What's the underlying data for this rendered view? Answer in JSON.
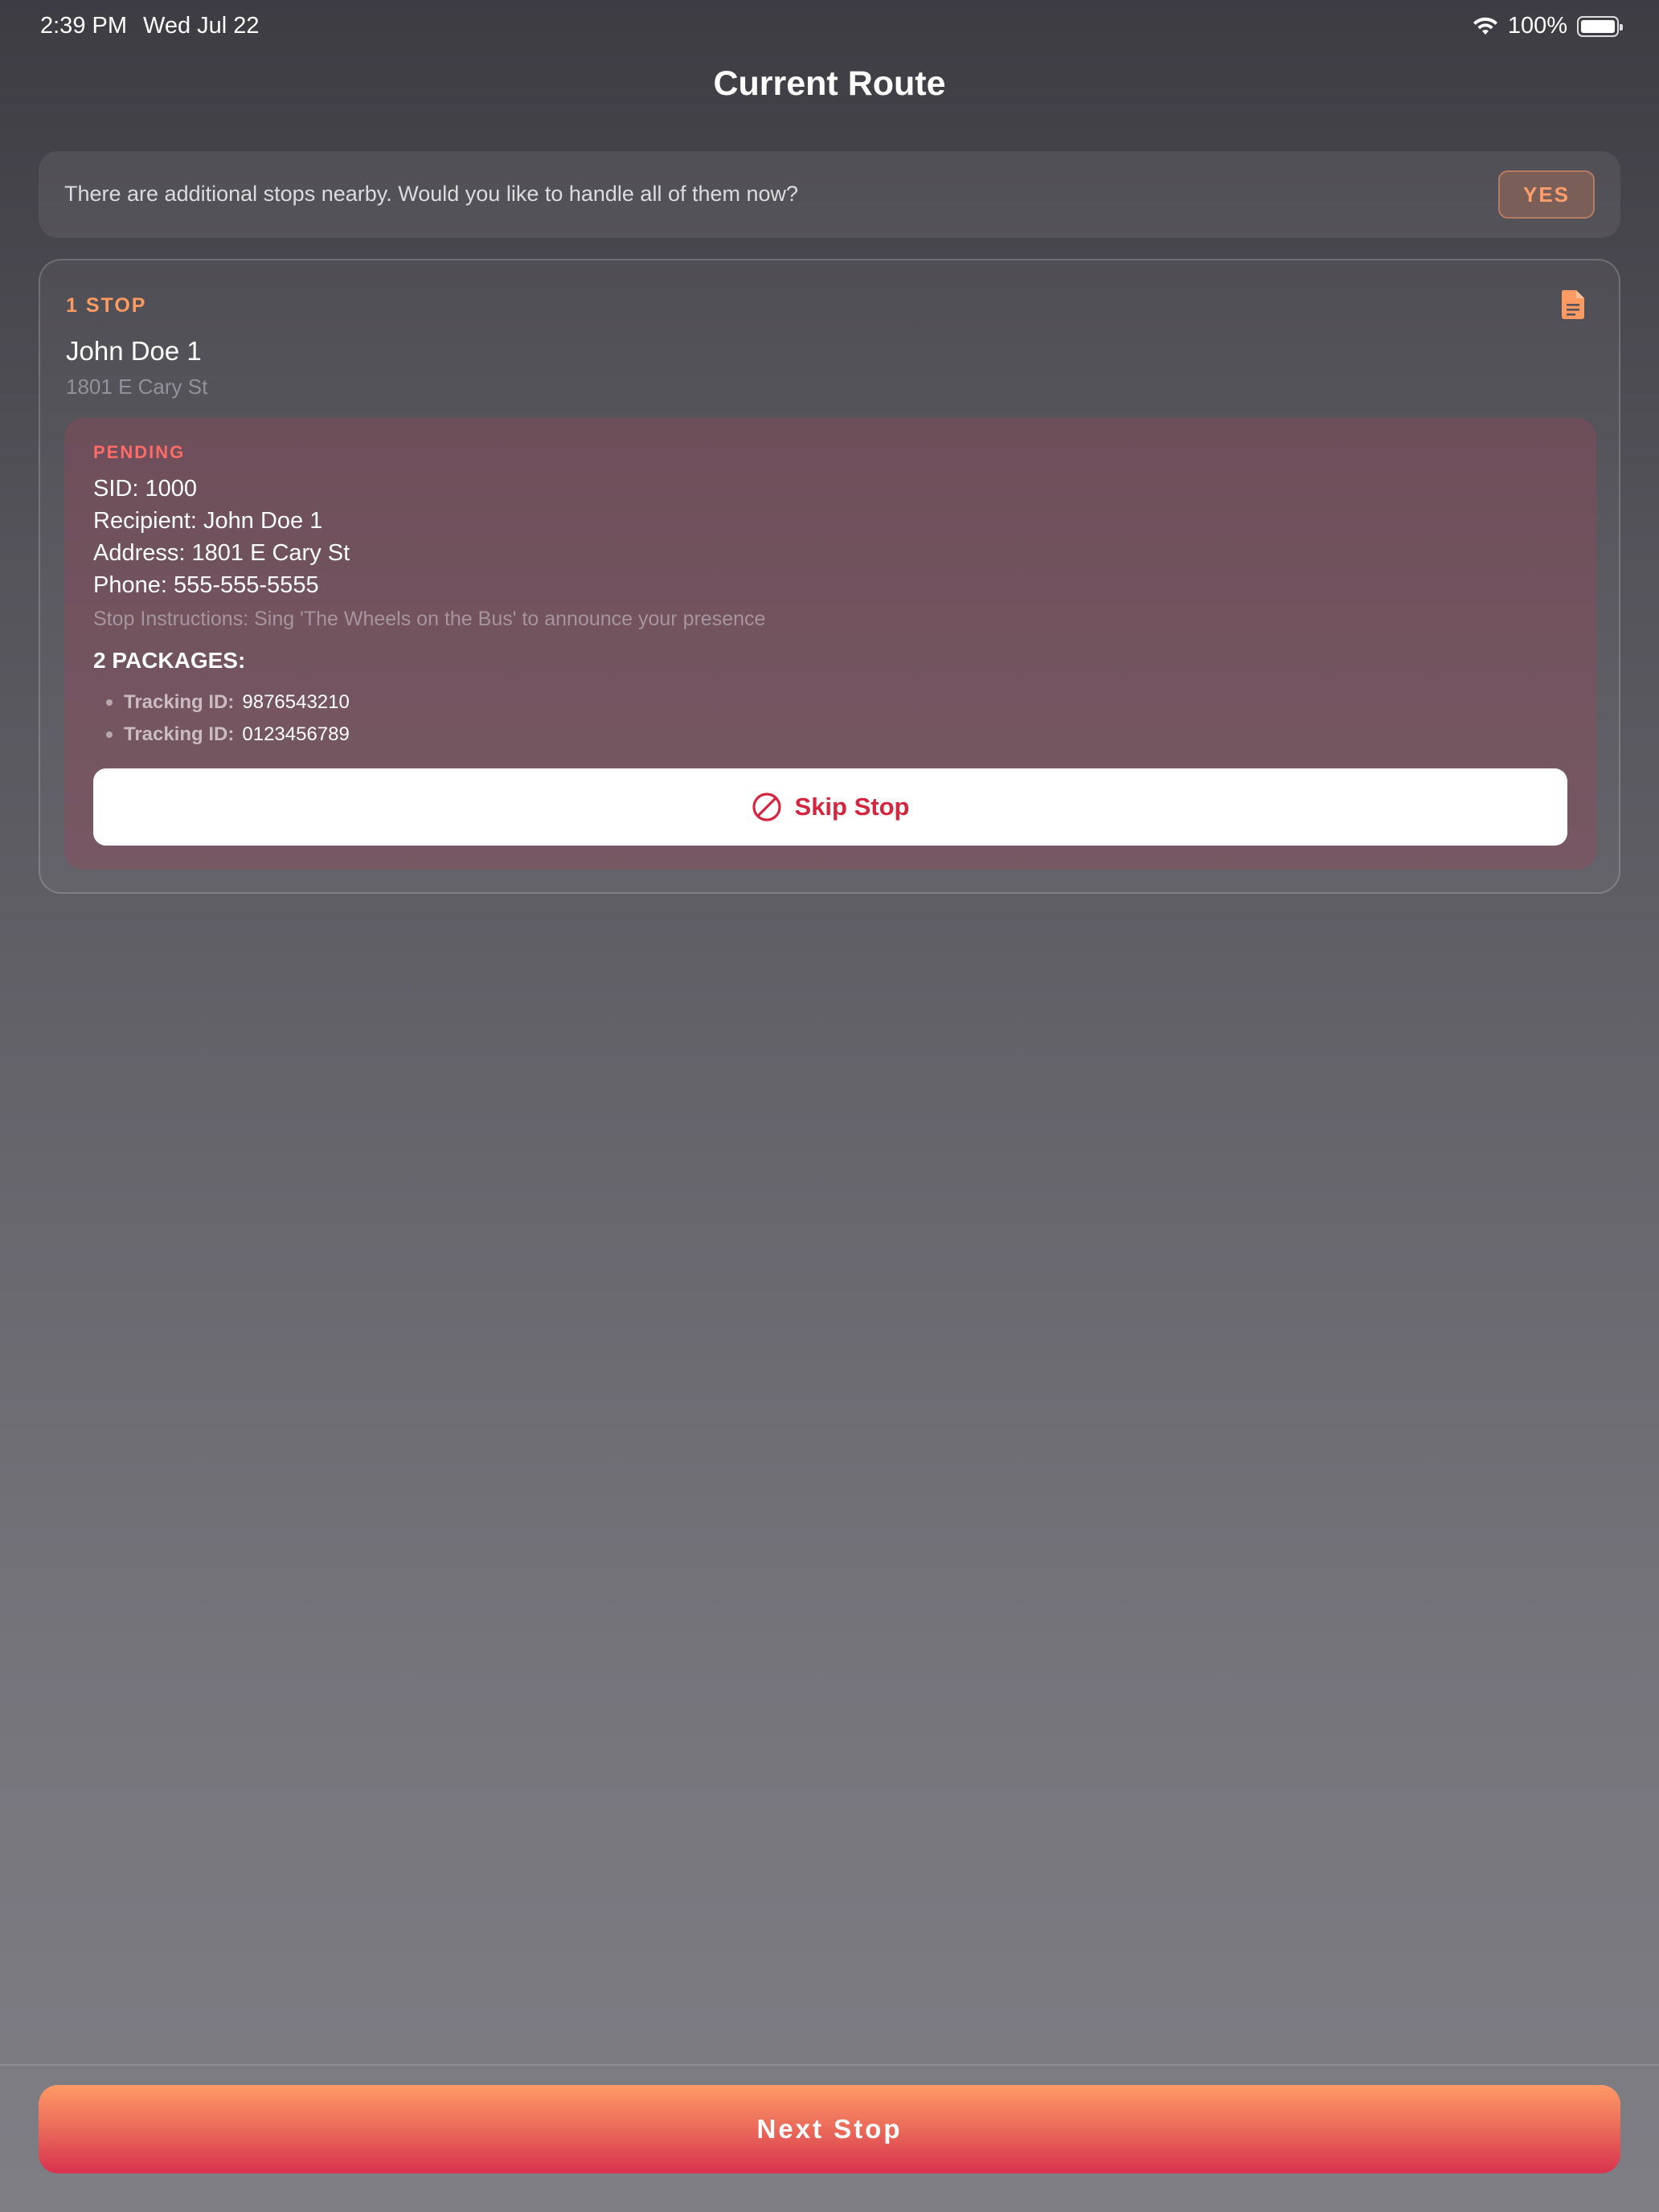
{
  "status_bar": {
    "time": "2:39 PM",
    "date": "Wed Jul 22",
    "battery": "100%"
  },
  "header": {
    "title": "Current Route"
  },
  "banner": {
    "message": "There are additional stops nearby. Would you like to handle all of them now?",
    "yes_label": "YES"
  },
  "stop_card": {
    "count_label": "1 STOP",
    "name": "John Doe 1",
    "address": "1801 E Cary St",
    "icon": "document-icon",
    "details": {
      "status": "PENDING",
      "sid": "SID: 1000",
      "recipient": "Recipient: John Doe 1",
      "address": "Address: 1801 E Cary St",
      "phone": "Phone: 555-555-5555",
      "instructions": "Stop Instructions:  Sing 'The Wheels on the Bus' to announce your presence",
      "packages_title": "2 PACKAGES:",
      "packages": [
        {
          "label": "Tracking ID:",
          "value": "9876543210"
        },
        {
          "label": "Tracking ID:",
          "value": "0123456789"
        }
      ],
      "skip_label": "Skip Stop"
    }
  },
  "footer": {
    "next_label": "Next Stop"
  },
  "colors": {
    "accent": "#ff9a62",
    "pending": "#ff6b66",
    "skip": "#d4273f"
  }
}
